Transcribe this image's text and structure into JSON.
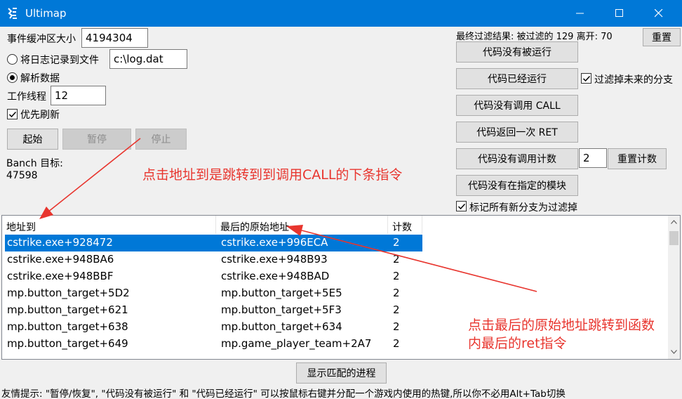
{
  "window": {
    "title": "Ultimap",
    "minimize_icon": "minimize-icon",
    "maximize_icon": "maximize-icon",
    "close_icon": "close-icon",
    "app_icon": "ultimap-logo-icon"
  },
  "settings": {
    "buffer_label": "事件缓冲区大小",
    "buffer_value": "4194304",
    "log_radio_label": "将日志记录到文件",
    "log_path_value": "c:\\log.dat",
    "parse_radio_label": "解析数据",
    "threads_label": "工作线程",
    "threads_value": "12",
    "priority_checkbox_label": "优先刷新",
    "start_label": "起始",
    "pause_label": "暂停",
    "stop_label": "停止",
    "target_label": "Banch 目标:",
    "target_value": "47598"
  },
  "filter": {
    "result_text": "最终过滤结果: 被过滤的 129 离开: 70",
    "reset_label": "重置",
    "not_executed_label": "代码没有被运行",
    "executed_label": "代码已经运行",
    "filter_future_label": "过滤掉未来的分支",
    "no_call_label": "代码没有调用 CALL",
    "ret_once_label": "代码返回一次 RET",
    "no_call_count_label": "代码没有调用计数",
    "count_value": "2",
    "reset_count_label": "重置计数",
    "not_in_module_label": "代码没有在指定的模块",
    "mark_new_label": "标记所有新分支为过滤掉"
  },
  "list": {
    "columns": [
      "地址到",
      "最后的原始地址",
      "计数"
    ],
    "rows": [
      [
        "cstrike.exe+928472",
        "cstrike.exe+996ECA",
        "2"
      ],
      [
        "cstrike.exe+948BA6",
        "cstrike.exe+948B93",
        "2"
      ],
      [
        "cstrike.exe+948BBF",
        "cstrike.exe+948BAD",
        "2"
      ],
      [
        "mp.button_target+5D2",
        "mp.button_target+5E5",
        "2"
      ],
      [
        "mp.button_target+621",
        "mp.button_target+5F3",
        "2"
      ],
      [
        "mp.button_target+638",
        "mp.button_target+634",
        "2"
      ],
      [
        "mp.button_target+649",
        "mp.game_player_team+2A7",
        "2"
      ]
    ],
    "selected_row": 0
  },
  "footer": {
    "show_process_label": "显示匹配的进程",
    "tip": "友情提示: \"暂停/恢复\", \"代码没有被运行\" 和 \"代码已经运行\" 可以按鼠标右键并分配一个游戏内使用的热键,所以你不必用Alt+Tab切换"
  },
  "annotations": {
    "note1": "点击地址到是跳转到到调用CALL的下条指令",
    "note2_line1": "点击最后的原始地址跳转到函数",
    "note2_line2": "内最后的ret指令",
    "color": "#e8352e"
  }
}
